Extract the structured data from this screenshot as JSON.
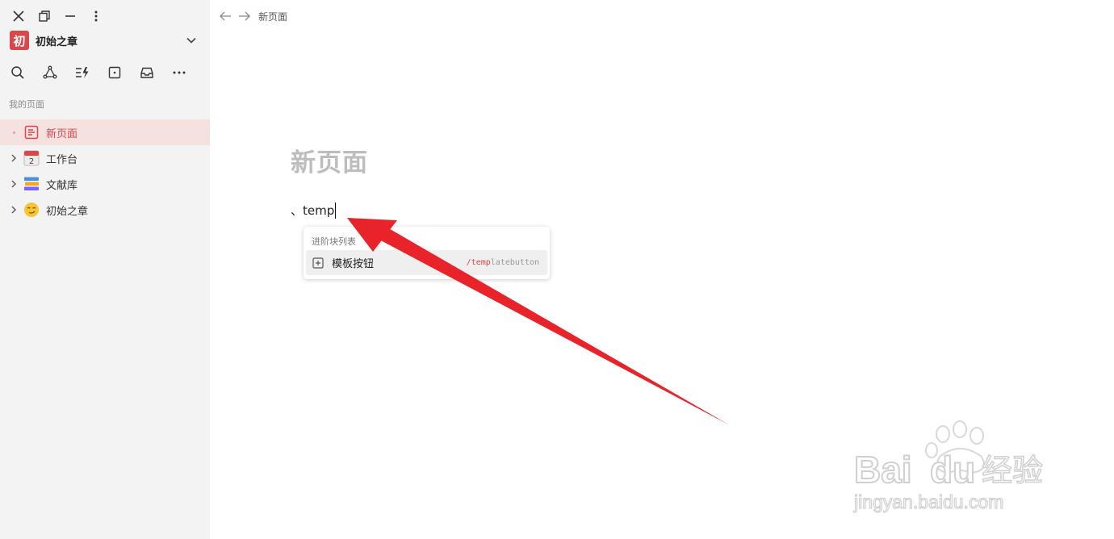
{
  "workspace": {
    "logo_char": "初",
    "name": "初始之章"
  },
  "sidebar": {
    "section_label": "我的页面",
    "items": [
      {
        "label": "新页面",
        "icon": "document-icon",
        "active": true
      },
      {
        "label": "工作台",
        "icon": "calendar-icon"
      },
      {
        "label": "文献库",
        "icon": "books-icon"
      },
      {
        "label": "初始之章",
        "icon": "smirk-face-icon"
      }
    ],
    "calendar_day": "2"
  },
  "breadcrumb": {
    "current": "新页面"
  },
  "page": {
    "title": "新页面",
    "input_prefix": "、",
    "input_text": "temp"
  },
  "popup": {
    "group_label": "进阶块列表",
    "items": [
      {
        "name": "模板按钮",
        "command_match": "/temp",
        "command_rest": "latebutton",
        "icon": "plus-square-icon"
      }
    ]
  },
  "watermark": {
    "brand": "Bai",
    "brand2": "du",
    "text_cn": "经验",
    "url": "jingyan.baidu.com"
  },
  "colors": {
    "accent": "#d7474b",
    "sidebar_bg": "#f3f3f3",
    "active_bg": "#f6e1e1",
    "arrow": "#e8242a"
  }
}
